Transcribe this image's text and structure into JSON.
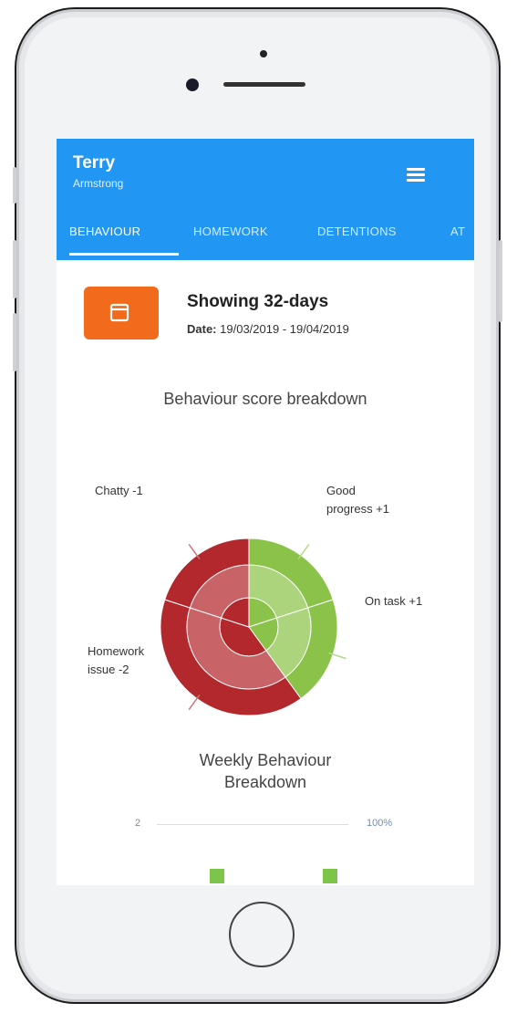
{
  "header": {
    "first_name": "Terry",
    "last_name": "Armstrong"
  },
  "tabs": [
    "BEHAVIOUR",
    "HOMEWORK",
    "DETENTIONS",
    "AT"
  ],
  "date_filter": {
    "showing": "Showing 32-days",
    "date_label": "Date:",
    "date_range": "19/03/2019 - 19/04/2019"
  },
  "charts": {
    "breakdown_title": "Behaviour score breakdown",
    "weekly_title_line1": "Weekly Behaviour",
    "weekly_title_line2": "Breakdown",
    "weekly_axis_min": "2",
    "weekly_axis_max": "100%"
  },
  "chart_data": [
    {
      "type": "pie",
      "title": "Behaviour score breakdown",
      "slices": [
        {
          "label": "Chatty -1",
          "value": -1,
          "color": "#b3282d"
        },
        {
          "label": "Homework issue -2",
          "value": -2,
          "color": "#b3282d"
        },
        {
          "label": "Good progress +1",
          "value": 1,
          "color": "#8bc34a"
        },
        {
          "label": "On task +1",
          "value": 1,
          "color": "#8bc34a"
        }
      ]
    }
  ],
  "labels": {
    "chatty": "Chatty -1",
    "good_progress_1": "Good",
    "good_progress_2": "progress +1",
    "on_task": "On task +1",
    "homework_1": "Homework",
    "homework_2": "issue -2"
  },
  "colors": {
    "app_bar": "#2196f3",
    "calendar_button": "#f26b1d",
    "negative": "#b3282d",
    "positive": "#8bc34a"
  }
}
